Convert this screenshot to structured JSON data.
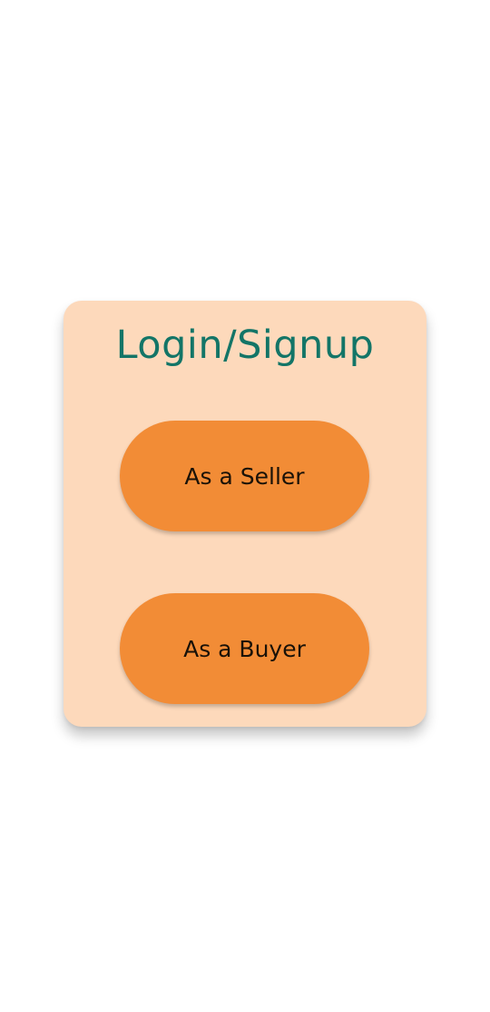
{
  "card": {
    "title": "Login/Signup"
  },
  "buttons": {
    "seller_label": "As a Seller",
    "buyer_label": "As a Buyer"
  },
  "colors": {
    "card_background": "#fdd9bb",
    "title_color": "#137567",
    "button_color": "#f28c36"
  }
}
